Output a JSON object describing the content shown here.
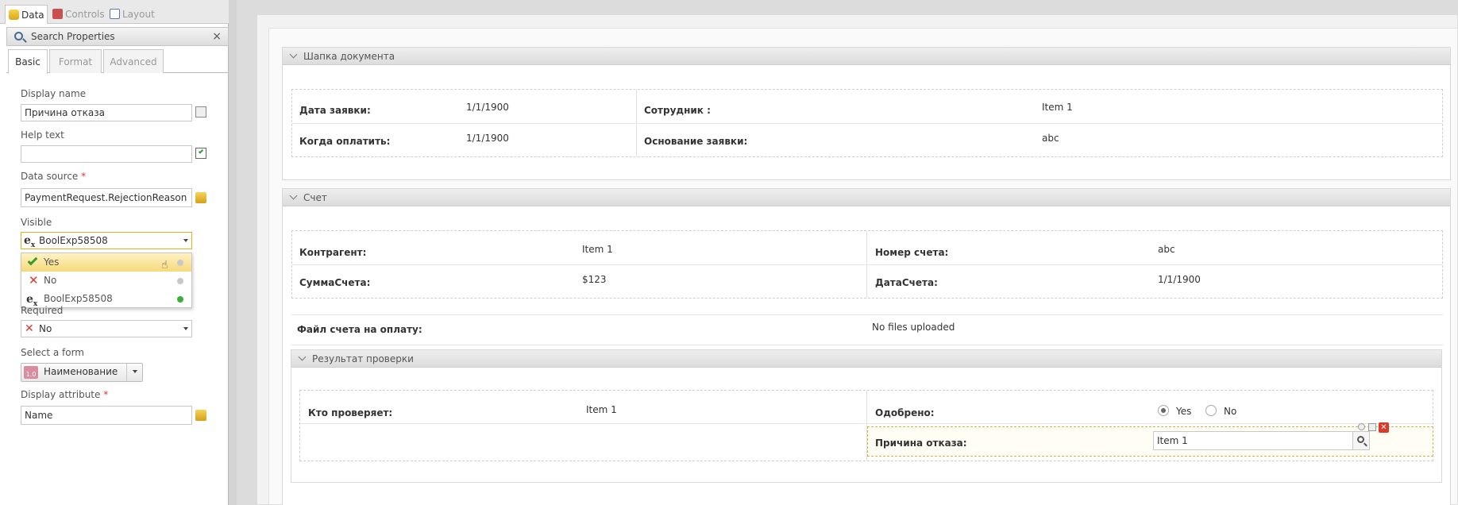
{
  "left_panel": {
    "top_tabs": [
      {
        "label": "Data",
        "active": true
      },
      {
        "label": "Controls",
        "active": false
      },
      {
        "label": "Layout",
        "active": false
      }
    ],
    "search": {
      "label": "Search Properties",
      "close": "×"
    },
    "sub_tabs": [
      {
        "label": "Basic",
        "active": true
      },
      {
        "label": "Format",
        "active": false
      },
      {
        "label": "Advanced",
        "active": false
      }
    ],
    "fields": {
      "display_name": {
        "label": "Display name",
        "value": "Причина отказа"
      },
      "help_text": {
        "label": "Help text",
        "value": ""
      },
      "data_source": {
        "label": "Data source",
        "required_mark": "*",
        "value": "PaymentRequest.RejectionReason"
      },
      "visible": {
        "label": "Visible",
        "value": "BoolExp58508",
        "icon": "ex"
      },
      "required": {
        "label": "Required",
        "value": "No"
      },
      "select_form": {
        "label": "Select a form",
        "value": "Наименование",
        "badge": "1.0"
      },
      "display_attribute": {
        "label": "Display attribute",
        "required_mark": "*",
        "value": "Name"
      }
    },
    "visible_dropdown": {
      "options": [
        {
          "label": "Yes",
          "dot_color": "#c8c8c8",
          "selected": true
        },
        {
          "label": "No",
          "dot_color": "#c8c8c8",
          "selected": false
        },
        {
          "label": "BoolExp58508",
          "dot_color": "#3cae3c",
          "selected": false
        }
      ]
    }
  },
  "form": {
    "header_section": {
      "title": "Шапка документа",
      "rows": [
        {
          "label": "Дата заявки:",
          "value": "1/1/1900",
          "label2": "Сотрудник :",
          "value2": "Item 1"
        },
        {
          "label": "Когда оплатить:",
          "value": "1/1/1900",
          "label2": "Основание заявки:",
          "value2": "abc"
        }
      ]
    },
    "invoice_section": {
      "title": "Счет",
      "rows": [
        {
          "label": "Контрагент:",
          "value": "Item 1",
          "label2": "Номер счета:",
          "value2": "abc"
        },
        {
          "label": "СуммаСчета:",
          "value": "$123",
          "label2": "ДатаСчета:",
          "value2": "1/1/1900"
        }
      ],
      "file_label": "Файл счета на оплату:",
      "file_value": "No files uploaded"
    },
    "check_section": {
      "title": "Результат проверки",
      "reviewer_label": "Кто проверяет:",
      "reviewer_value": "Item 1",
      "approved_label": "Одобрено:",
      "approved_options": [
        {
          "label": "Yes",
          "checked": true
        },
        {
          "label": "No",
          "checked": false
        }
      ],
      "reason_label": "Причина отказа:",
      "reason_value": "Item 1"
    }
  }
}
